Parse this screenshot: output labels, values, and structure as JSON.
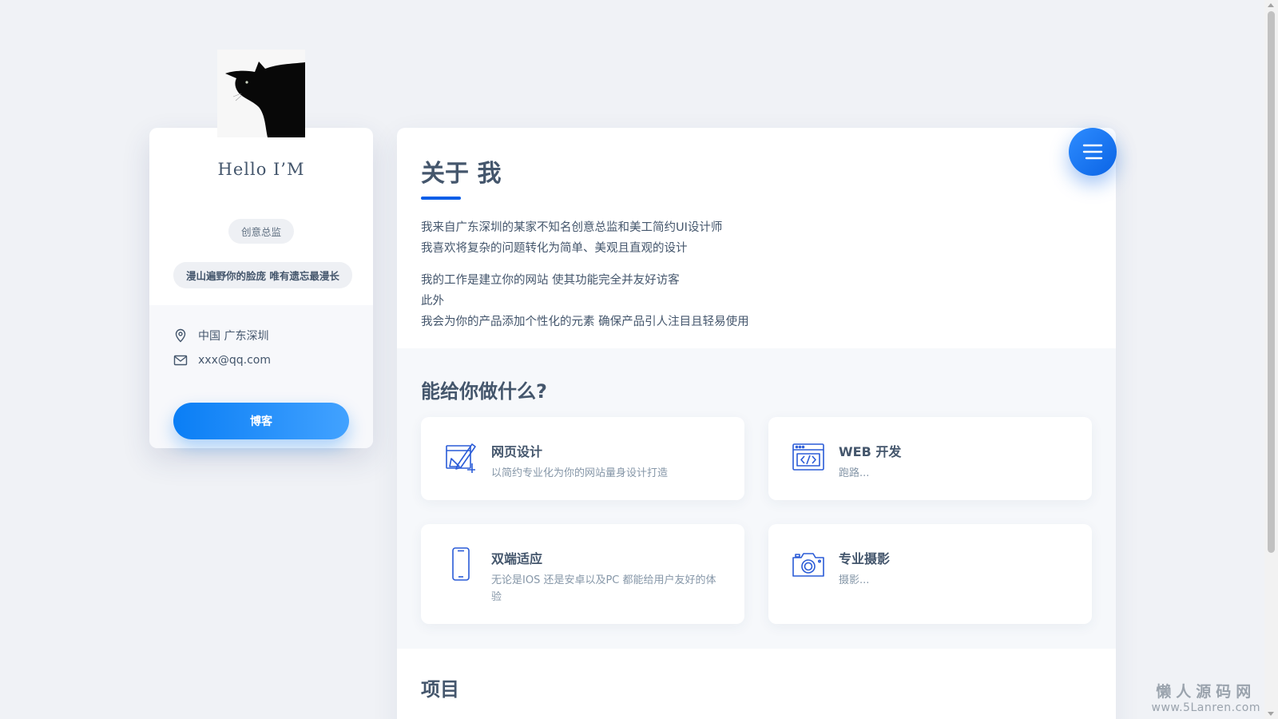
{
  "profile": {
    "greeting": "Hello I’M",
    "role": "创意总监",
    "motto": "漫山遍野你的脸庞 唯有遗忘最漫长",
    "location": "中国 广东深圳",
    "email": "xxx@qq.com",
    "blog_button": "博客"
  },
  "about": {
    "title": "关于 我",
    "para1": [
      "我来自广东深圳的某家不知名创意总监和美工简约UI设计师",
      "我喜欢将复杂的问题转化为简单、美观且直观的设计"
    ],
    "para2": [
      "我的工作是建立你的网站 使其功能完全并友好访客",
      "此外",
      "我会为你的产品添加个性化的元素 确保产品引人注目且轻易使用"
    ]
  },
  "services": {
    "title": "能给你做什么?",
    "items": [
      {
        "title": "网页设计",
        "desc": "以简约专业化为你的网站量身设计打造",
        "icon": "design-pencil-icon"
      },
      {
        "title": "WEB 开发",
        "desc": "跑路...",
        "icon": "code-window-icon"
      },
      {
        "title": "双端适应",
        "desc": "无论是IOS 还是安卓以及PC 都能给用户友好的体验",
        "icon": "smartphone-icon"
      },
      {
        "title": "专业摄影",
        "desc": "摄影...",
        "icon": "camera-icon"
      }
    ]
  },
  "projects": {
    "title": "项目"
  },
  "watermark": {
    "main": "懒人源码网",
    "sub": "www.5Lanren.com"
  },
  "colors": {
    "accent": "#0b64e5",
    "text": "#44566c",
    "muted": "#8697a8",
    "background": "#f0f2f6"
  }
}
